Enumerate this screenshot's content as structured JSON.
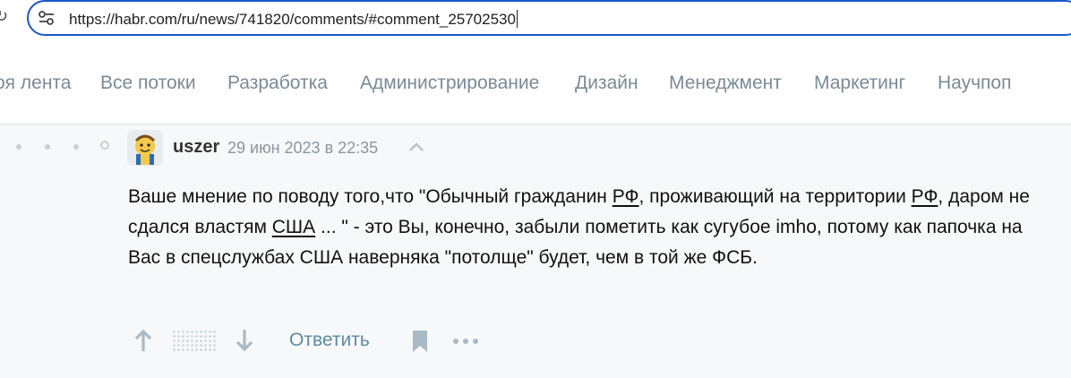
{
  "browser": {
    "url": "https://habr.com/ru/news/741820/comments/#comment_25702530"
  },
  "nav": {
    "items": [
      {
        "label": "оя лента"
      },
      {
        "label": "Все потоки"
      },
      {
        "label": "Разработка"
      },
      {
        "label": "Администрирование"
      },
      {
        "label": "Дизайн"
      },
      {
        "label": "Менеджмент"
      },
      {
        "label": "Маркетинг"
      },
      {
        "label": "Научпоп"
      }
    ]
  },
  "comment": {
    "username": "uszer",
    "timestamp": "29 июн 2023 в 22:35",
    "text": {
      "p1": "Ваше мнение по поводу того,что \"Обычный гражданин ",
      "l1": "РФ",
      "p2": ", проживающий на территории ",
      "l2": "РФ",
      "p3": ", даром не сдался властям ",
      "l3": "США",
      "p4": " ... \" - это Вы, конечно, забыли пометить как сугубое imho, потому как папочка на Вас в спецслужбах США наверняка \"потолще\" будет, чем в той же ФСБ."
    },
    "reply_label": "Ответить"
  },
  "colors": {
    "accent": "#1a57c9",
    "nav_text": "#7b8a95",
    "reply": "#5e8aa1"
  }
}
